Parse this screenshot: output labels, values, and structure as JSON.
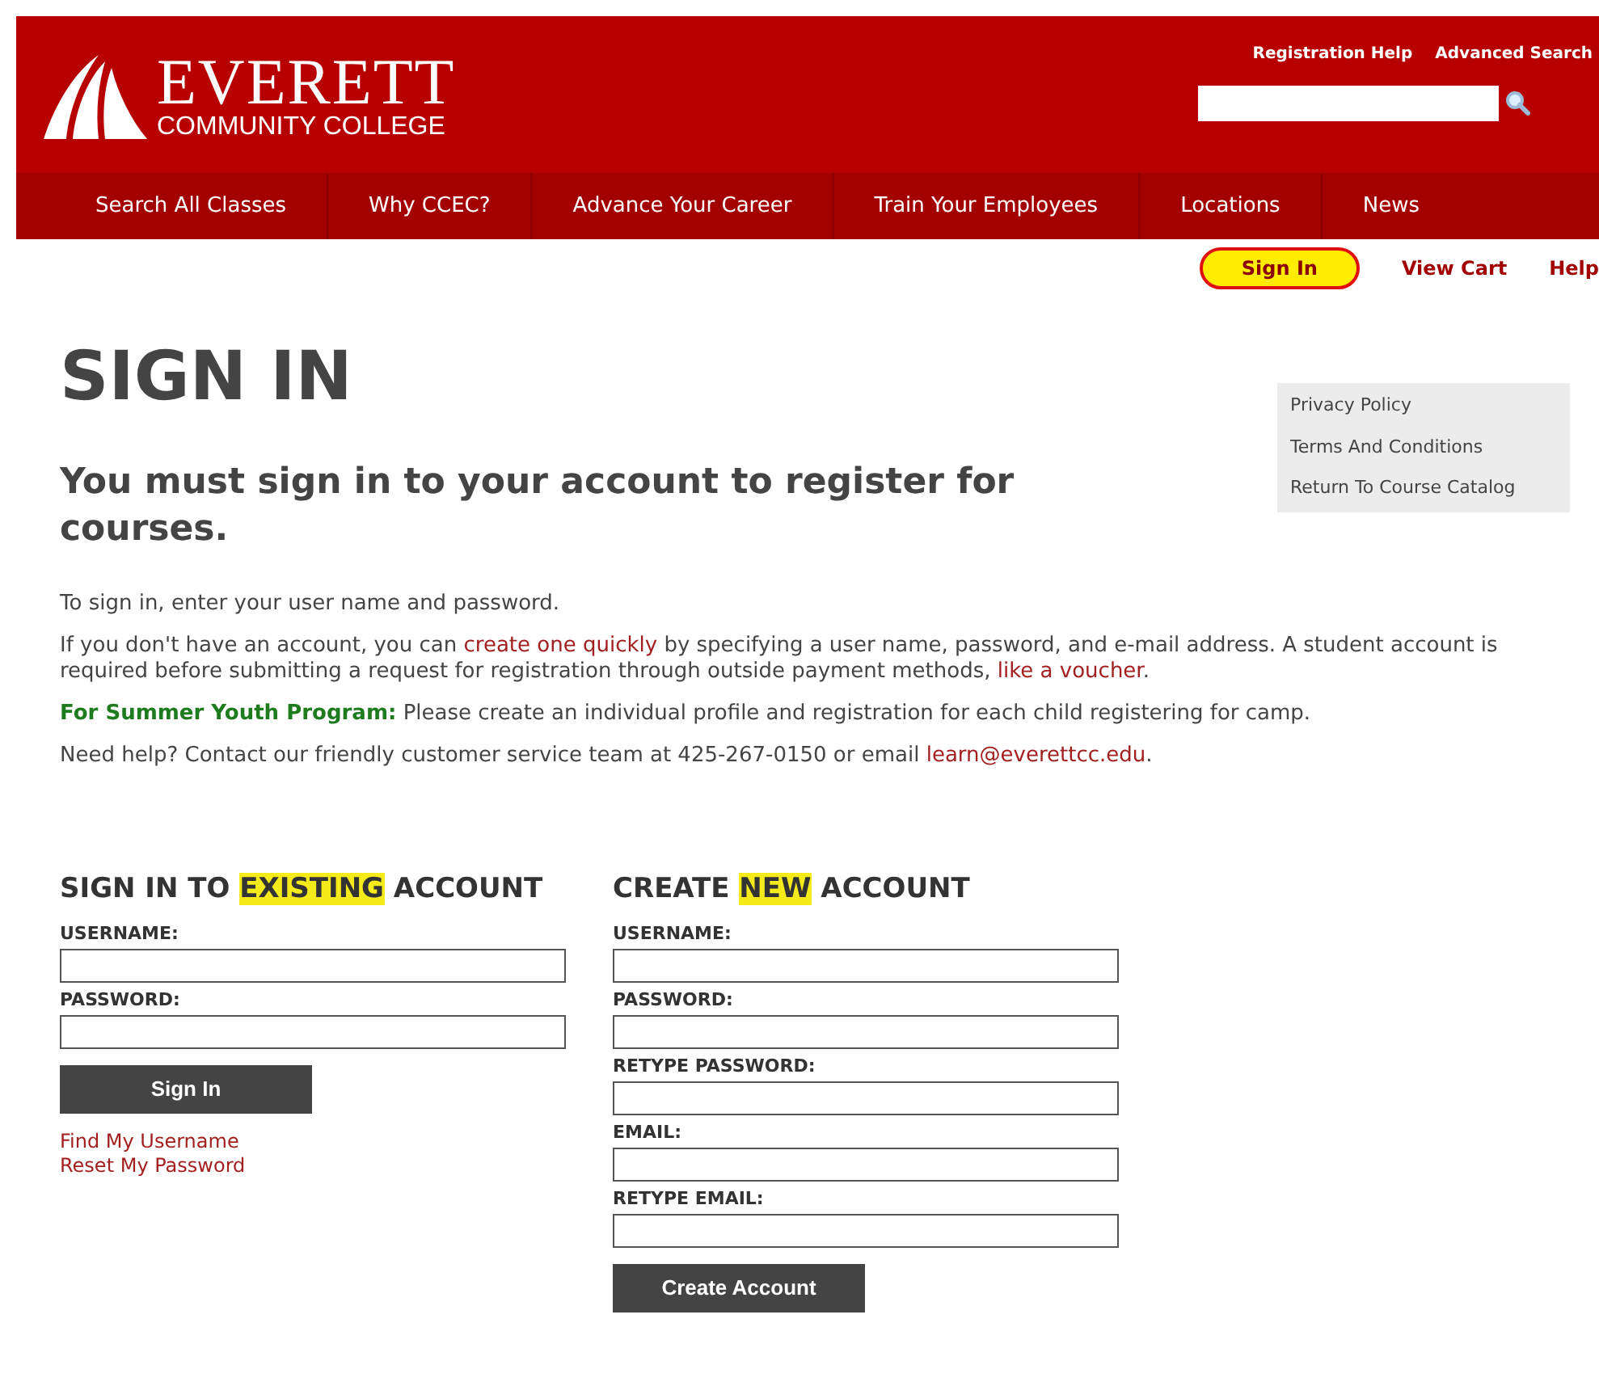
{
  "header": {
    "logo": {
      "name": "EVERETT",
      "subtitle": "COMMUNITY COLLEGE"
    },
    "top_links": [
      "Registration Help",
      "Advanced Search"
    ]
  },
  "nav": [
    "Search All Classes",
    "Why CCEC?",
    "Advance Your Career",
    "Train Your Employees",
    "Locations",
    "News"
  ],
  "user_links": [
    {
      "label": "Sign In",
      "highlighted": true
    },
    {
      "label": "View Cart",
      "highlighted": false
    },
    {
      "label": "Help",
      "highlighted": false
    }
  ],
  "sidebar": [
    "Privacy Policy",
    "Terms And Conditions",
    "Return To Course Catalog"
  ],
  "title": "SIGN IN",
  "subtitle": "You must sign in to your account to register for courses.",
  "paragraphs": [
    [
      {
        "kind": "text",
        "text": "To sign in, enter your user name and password."
      }
    ],
    [
      {
        "kind": "text",
        "text": "If you don't have an account, you can "
      },
      {
        "kind": "link",
        "text": "create one quickly"
      },
      {
        "kind": "text",
        "text": " by specifying a user name, password, and e-mail address. A student account is required before submitting a request for registration through outside payment methods, "
      },
      {
        "kind": "link",
        "text": "like a voucher"
      },
      {
        "kind": "text",
        "text": "."
      }
    ],
    [
      {
        "kind": "label",
        "text": "For Summer Youth Program:"
      },
      {
        "kind": "text",
        "text": " Please create an individual profile and registration for each child registering for camp."
      }
    ],
    [
      {
        "kind": "text",
        "text": "Need help? Contact our friendly customer service team at 425-267-0150 or email "
      },
      {
        "kind": "link",
        "text": "learn@everettcc.edu"
      },
      {
        "kind": "text",
        "text": "."
      }
    ]
  ],
  "forms": [
    {
      "heading": [
        {
          "text": "SIGN IN TO ",
          "highlighted": false
        },
        {
          "text": "EXISTING",
          "highlighted": true
        },
        {
          "text": " ACCOUNT",
          "highlighted": false
        }
      ],
      "fields": [
        "USERNAME:",
        "PASSWORD:"
      ],
      "button": "Sign In",
      "links": [
        "Find My Username",
        "Reset My Password"
      ]
    },
    {
      "heading": [
        {
          "text": "CREATE ",
          "highlighted": false
        },
        {
          "text": "NEW",
          "highlighted": true
        },
        {
          "text": " ACCOUNT",
          "highlighted": false
        }
      ],
      "fields": [
        "USERNAME:",
        "PASSWORD:",
        "RETYPE PASSWORD:",
        "EMAIL:",
        "RETYPE EMAIL:"
      ],
      "button": "Create Account"
    }
  ]
}
